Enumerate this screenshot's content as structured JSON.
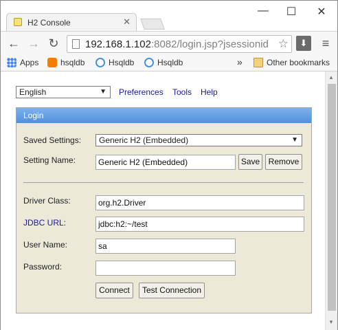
{
  "tab": {
    "title": "H2 Console",
    "close": "✕"
  },
  "window_controls": {
    "minimize": "—",
    "maximize": "☐",
    "close": "✕"
  },
  "nav": {
    "back": "←",
    "forward": "→",
    "reload": "↻",
    "url_host": "192.168.1.102",
    "url_rest": ":8082/login.jsp?jsessionid",
    "star": "☆",
    "download": "⬇",
    "menu": "≡"
  },
  "bookmarks": {
    "items": [
      {
        "label": "Apps",
        "icon": "apps-grid-icon",
        "color": "#4285f4"
      },
      {
        "label": "hsqldb",
        "icon": "blogger-icon",
        "color": "#f57d00"
      },
      {
        "label": "Hsqldb",
        "icon": "search-icon",
        "color": "#4a90d9"
      },
      {
        "label": "Hsqldb",
        "icon": "search-icon",
        "color": "#4a90d9"
      }
    ],
    "overflow": "»",
    "other": "Other bookmarks"
  },
  "page": {
    "language": "English",
    "links": [
      "Preferences",
      "Tools",
      "Help"
    ],
    "panel_title": "Login",
    "saved_settings_label": "Saved Settings:",
    "saved_settings_value": "Generic H2 (Embedded)",
    "setting_name_label": "Setting Name:",
    "setting_name_value": "Generic H2 (Embedded)",
    "save_label": "Save",
    "remove_label": "Remove",
    "driver_class_label": "Driver Class:",
    "driver_class_value": "org.h2.Driver",
    "jdbc_url_label": "JDBC URL:",
    "jdbc_url_value": "jdbc:h2:~/test",
    "user_name_label": "User Name:",
    "user_name_value": "sa",
    "password_label": "Password:",
    "password_value": "",
    "connect_label": "Connect",
    "test_connection_label": "Test Connection"
  },
  "colors": {
    "panel_bg": "#ece9d8",
    "panel_header": "#5b96de",
    "link": "#1a1a9a"
  }
}
